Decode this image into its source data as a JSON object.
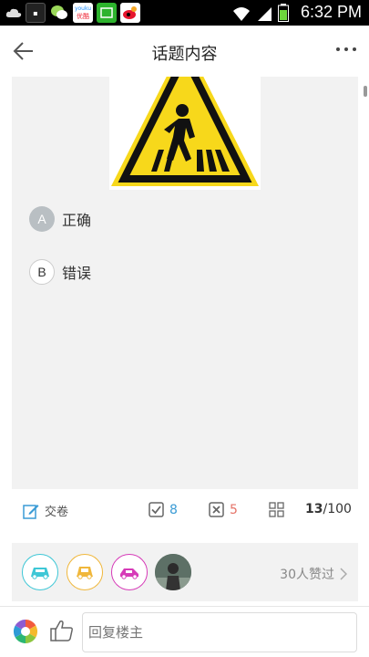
{
  "status_bar": {
    "time": "6:32 PM",
    "app_icons": [
      "cloud-icon",
      "news-icon",
      "wechat-icon",
      "youku-icon",
      "iqiyi-icon",
      "weibo-icon"
    ],
    "app_labels": [
      "",
      "",
      "",
      "优酷",
      "",
      ""
    ]
  },
  "header": {
    "title": "话题内容"
  },
  "question": {
    "options": [
      {
        "letter": "A",
        "text": "正确",
        "selected": true
      },
      {
        "letter": "B",
        "text": "错误",
        "selected": false
      }
    ]
  },
  "toolbar": {
    "submit_label": "交卷",
    "correct_count": "8",
    "wrong_count": "5",
    "progress_current": "13",
    "progress_total": "/100"
  },
  "likes": {
    "count_text": "30人赞过"
  },
  "reply": {
    "placeholder": "回复楼主"
  },
  "colors": {
    "accent_blue": "#3a9bd5",
    "accent_red": "#e57368",
    "sign_yellow": "#f7d81b"
  }
}
